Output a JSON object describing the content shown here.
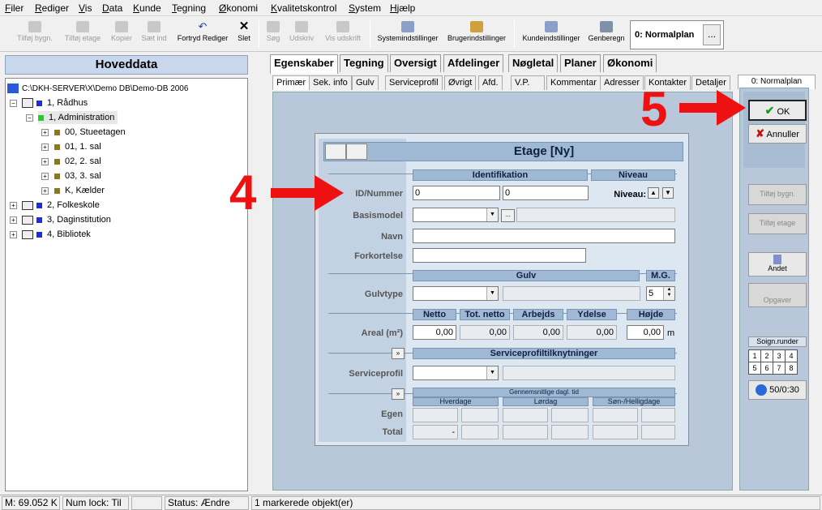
{
  "menu": [
    "Filer",
    "Rediger",
    "Vis",
    "Data",
    "Kunde",
    "Tegning",
    "Økonomi",
    "Kvalitetskontrol",
    "System",
    "Hjælp"
  ],
  "toolbar": [
    {
      "label": "Tilføj bygn.",
      "enabled": false
    },
    {
      "label": "Tilføj etage",
      "enabled": false
    },
    {
      "label": "Kopier",
      "enabled": false
    },
    {
      "label": "Sæt ind",
      "enabled": false
    },
    {
      "label": "Fortryd Rediger",
      "enabled": true
    },
    {
      "label": "Slet",
      "enabled": true
    },
    {
      "label": "Søg",
      "enabled": false
    },
    {
      "label": "Udskriv",
      "enabled": false
    },
    {
      "label": "Vis udskrift",
      "enabled": false
    },
    {
      "label": "Systemindstillinger",
      "enabled": true
    },
    {
      "label": "Brugerindstillinger",
      "enabled": true
    },
    {
      "label": "Kundeindstillinger",
      "enabled": true
    },
    {
      "label": "Genberegn",
      "enabled": true
    }
  ],
  "plan": {
    "label": "0: Normalplan",
    "button": "..."
  },
  "left": {
    "header": "Hoveddata",
    "root": "C:\\DKH-SERVER\\X\\Demo DB\\Demo-DB 2006",
    "nodes": [
      "1, Rådhus",
      "1, Administration",
      "00, Stueetagen",
      "01, 1. sal",
      "02, 2. sal",
      "03, 3. sal",
      "K, Kælder",
      "2, Folkeskole",
      "3, Daginstitution",
      "4, Bibliotek"
    ]
  },
  "tabs_main": [
    "Egenskaber",
    "Tegning",
    "Oversigt",
    "Afdelinger",
    "Nøgletal",
    "Planer",
    "Økonomi"
  ],
  "tabs_sub": [
    "Primær",
    "Sek. info",
    "Gulv",
    "Serviceprofil",
    "Øvrigt",
    "Afd.",
    "V.P.",
    "Kommentar",
    "Adresser",
    "Kontakter",
    "Detaljer"
  ],
  "plan_tab": "0: Normalplan",
  "dialog": {
    "title": "Etage [Ny]",
    "sec_ident": "Identifikation",
    "sec_niveau": "Niveau",
    "lbl_id": "ID/Nummer",
    "id_value": "0",
    "nummer_value": "0",
    "lbl_niveau": "Niveau:",
    "lbl_basismodel": "Basismodel",
    "basismodel_btn": "...",
    "lbl_navn": "Navn",
    "lbl_forkortelse": "Forkortelse",
    "sec_gulv": "Gulv",
    "sec_mg": "M.G.",
    "lbl_gulvtype": "Gulvtype",
    "mg_value": "5",
    "col_netto": "Netto",
    "col_totnetto": "Tot. netto",
    "col_arbejds": "Arbejds",
    "col_ydelse": "Ydelse",
    "col_hojde": "Højde",
    "lbl_areal": "Areal (m²)",
    "netto": "0,00",
    "totnetto": "0,00",
    "arbejds": "0,00",
    "ydelse": "0,00",
    "hojde": "0,00",
    "unit_m": "m",
    "expand": "»",
    "sec_service": "Serviceprofiltilknytninger",
    "lbl_serviceprofil": "Serviceprofil",
    "sec_gennem": "Gennemsnitlige dagl. tid",
    "col_hverdage": "Hverdage",
    "col_lordag": "Lørdag",
    "col_son": "Søn-/Helligdage",
    "lbl_egen": "Egen",
    "lbl_total": "Total",
    "total_dash": "-"
  },
  "right": {
    "ok": "OK",
    "cancel": "Annuller",
    "add_bygn": "Tilføj bygn.",
    "add_etage": "Tilføj etage",
    "andet": "Andet",
    "opgaver": "Opgaver",
    "soign": "Soign.runder",
    "grid": [
      "1",
      "2",
      "3",
      "4",
      "5",
      "6",
      "7",
      "8"
    ],
    "time": "50/0:30"
  },
  "annotations": {
    "n4": "4",
    "n5": "5"
  },
  "status": [
    "M: 69.052 K",
    "Num lock: Til",
    "",
    "Status: Ændre",
    "1 markerede objekt(er)"
  ],
  "colors": {
    "accent": "#9fb8d4",
    "arrow": "#ee1111"
  }
}
